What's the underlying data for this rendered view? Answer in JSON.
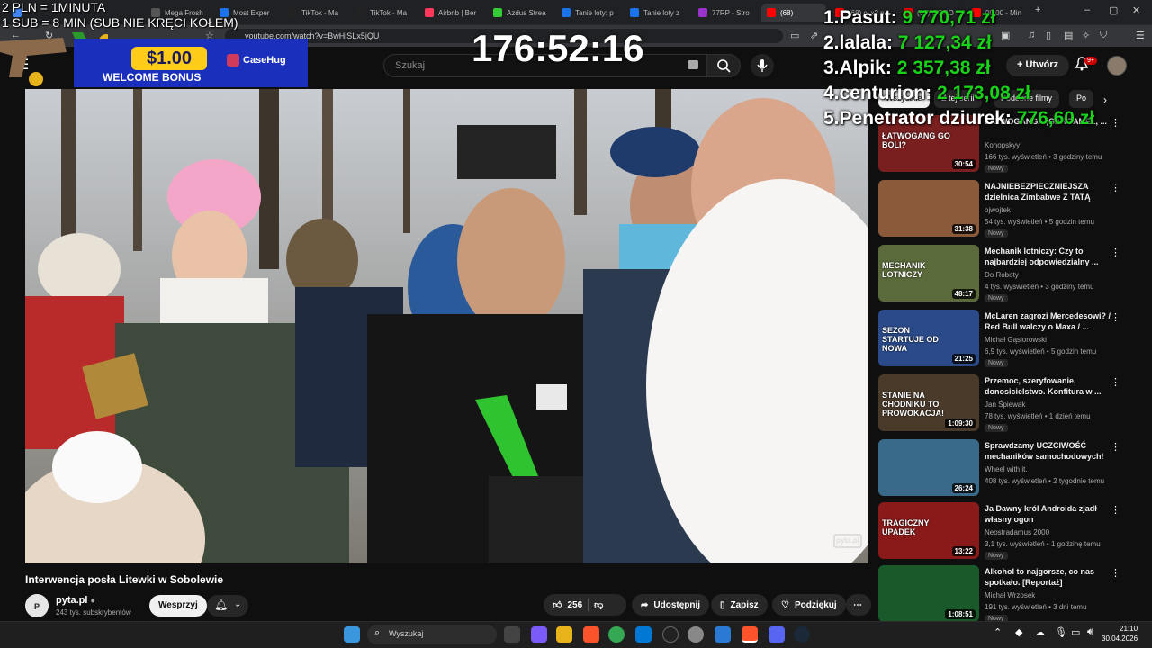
{
  "browser": {
    "tabs": [
      {
        "label": "",
        "color": "#4285f4"
      },
      {
        "label": "Mega Frosh",
        "color": "#555"
      },
      {
        "label": "Most Exper",
        "color": "#1a73e8"
      },
      {
        "label": "TikTok - Ma",
        "color": "#222"
      },
      {
        "label": "TikTok - Ma",
        "color": "#222"
      },
      {
        "label": "Airbnb | Ber",
        "color": "#ff385c"
      },
      {
        "label": "Azdus Strea",
        "color": "#33cc33"
      },
      {
        "label": "Tanie loty: p",
        "color": "#1a73e8"
      },
      {
        "label": "Tanie loty z",
        "color": "#1a73e8"
      },
      {
        "label": "77RP - Stro",
        "color": "#9933cc"
      },
      {
        "label": "(68)",
        "color": "#ff0000"
      },
      {
        "label": "(68) cl x2 p",
        "color": "#ff0000"
      },
      {
        "label": "(68) OGRO",
        "color": "#ff0000"
      },
      {
        "label": "00:00 - Min",
        "color": "#ff0000"
      }
    ],
    "url": "youtube.com/watch?v=BwHiSLx5jQU"
  },
  "youtube": {
    "search_placeholder": "Szukaj",
    "create_label": "Utwórz",
    "notifications_badge": "9+",
    "chips": [
      "Wszystkie",
      "Z tej serii",
      "Podobne filmy",
      "Po"
    ],
    "video": {
      "title": "Interwencja posła Litewki w Sobolewie",
      "channel": "pyta.pl",
      "subscribers": "243 tys. subskrybentów",
      "support_label": "Wesprzyj",
      "likes": "256",
      "share_label": "Udostępnij",
      "save_label": "Zapisz",
      "thanks_label": "Podziękuj",
      "watermark": "pyta.pl"
    },
    "recommendations": [
      {
        "title": "ŁATWOGANGA (GARGAMEL, ...",
        "channel": "Konopskyy",
        "meta": "166 tys. wyświetleń • 3 godziny temu",
        "badge": "Nowy",
        "duration": "30:54",
        "thumb_text": "ŁATWOGANG GO BOLI?",
        "thumb_color": "#7a1f1f"
      },
      {
        "title": "NAJNIEBEZPIECZNIEJSZA dzielnica Zimbabwe Z TATĄ",
        "channel": "ojwojtek",
        "meta": "54 tys. wyświetleń • 5 godzin temu",
        "badge": "Nowy",
        "duration": "31:38",
        "thumb_text": "",
        "thumb_color": "#8a5a3a"
      },
      {
        "title": "Mechanik lotniczy: Czy to najbardziej odpowiedzialny ...",
        "channel": "Do Roboty",
        "meta": "4 tys. wyświetleń • 3 godziny temu",
        "badge": "Nowy",
        "duration": "48:17",
        "thumb_text": "MECHANIK LOTNICZY",
        "thumb_color": "#5a6a3a"
      },
      {
        "title": "McLaren zagrozi Mercedesowi? / Red Bull walczy o Maxa / ...",
        "channel": "Michał Gąsiorowski",
        "meta": "6,9 tys. wyświetleń • 5 godzin temu",
        "badge": "Nowy",
        "duration": "21:25",
        "thumb_text": "SEZON STARTUJE OD NOWA",
        "thumb_color": "#2a4a8a"
      },
      {
        "title": "Przemoc, szeryfowanie, donosicielstwo. Konfitura w ...",
        "channel": "Jan Śpiewak",
        "meta": "78 tys. wyświetleń • 1 dzień temu",
        "badge": "Nowy",
        "duration": "1:09:30",
        "thumb_text": "STANIE NA CHODNIKU TO PROWOKACJA!",
        "thumb_color": "#4a3a2a"
      },
      {
        "title": "Sprawdzamy UCZCIWOŚĆ mechaników samochodowych!",
        "channel": "Wheel with it.",
        "meta": "408 tys. wyświetleń • 2 tygodnie temu",
        "badge": "",
        "duration": "26:24",
        "thumb_text": "",
        "thumb_color": "#3a6a8a"
      },
      {
        "title": "Ja Dawny król Androida zjadł własny ogon",
        "channel": "Neostradamus 2000",
        "meta": "3,1 tys. wyświetleń • 1 godzinę temu",
        "badge": "Nowy",
        "duration": "13:22",
        "thumb_text": "TRAGICZNY UPADEK",
        "thumb_color": "#8a1a1a"
      },
      {
        "title": "Alkohol to najgorsze, co nas spotkało. [Reportaż]",
        "channel": "Michał Wrzosek",
        "meta": "191 tys. wyświetleń • 3 dni temu",
        "badge": "Nowy",
        "duration": "1:08:51",
        "thumb_text": "",
        "thumb_color": "#1a5a2a"
      }
    ]
  },
  "overlay": {
    "rule1": "2 PLN =  1MINUTA",
    "rule2": "1 SUB = 8 MIN (SUB NIE KRĘCI KOŁEM)",
    "timer": "176:52:16",
    "leaderboard": [
      {
        "rank": "1.",
        "name": "Pasut:",
        "amount": "9 770,71 zł"
      },
      {
        "rank": "2.",
        "name": "lalala:",
        "amount": "7 127,34 zł"
      },
      {
        "rank": "3.",
        "name": "Alpik:",
        "amount": "2 357,38 zł"
      },
      {
        "rank": "4.",
        "name": "centurion:",
        "amount": "2 173,08 zł"
      },
      {
        "rank": "5.",
        "name": "Penetrator dziurek:",
        "amount": "776,60 zł"
      }
    ],
    "banner": {
      "amount": "$1.00",
      "text": "WELCOME BONUS",
      "brand": "CaseHug"
    }
  },
  "taskbar": {
    "search_placeholder": "Wyszukaj",
    "time": "21:10",
    "date": "30.04.2026"
  }
}
